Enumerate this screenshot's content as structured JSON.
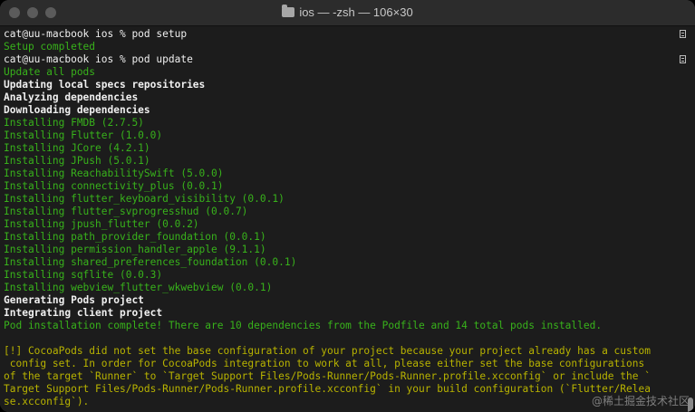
{
  "window": {
    "title": "ios — -zsh — 106×30"
  },
  "terminal": {
    "lines": [
      {
        "text": "cat@uu-macbook ios % pod setup",
        "style": "prompt"
      },
      {
        "text": "Setup completed",
        "style": "green"
      },
      {
        "text": "cat@uu-macbook ios % pod update",
        "style": "prompt"
      },
      {
        "text": "Update all pods",
        "style": "green"
      },
      {
        "text": "Updating local specs repositories",
        "style": "bold"
      },
      {
        "text": "Analyzing dependencies",
        "style": "bold"
      },
      {
        "text": "Downloading dependencies",
        "style": "bold"
      },
      {
        "text": "Installing FMDB (2.7.5)",
        "style": "green"
      },
      {
        "text": "Installing Flutter (1.0.0)",
        "style": "green"
      },
      {
        "text": "Installing JCore (4.2.1)",
        "style": "green"
      },
      {
        "text": "Installing JPush (5.0.1)",
        "style": "green"
      },
      {
        "text": "Installing ReachabilitySwift (5.0.0)",
        "style": "green"
      },
      {
        "text": "Installing connectivity_plus (0.0.1)",
        "style": "green"
      },
      {
        "text": "Installing flutter_keyboard_visibility (0.0.1)",
        "style": "green"
      },
      {
        "text": "Installing flutter_svprogresshud (0.0.7)",
        "style": "green"
      },
      {
        "text": "Installing jpush_flutter (0.0.2)",
        "style": "green"
      },
      {
        "text": "Installing path_provider_foundation (0.0.1)",
        "style": "green"
      },
      {
        "text": "Installing permission_handler_apple (9.1.1)",
        "style": "green"
      },
      {
        "text": "Installing shared_preferences_foundation (0.0.1)",
        "style": "green"
      },
      {
        "text": "Installing sqflite (0.0.3)",
        "style": "green"
      },
      {
        "text": "Installing webview_flutter_wkwebview (0.0.1)",
        "style": "green"
      },
      {
        "text": "Generating Pods project",
        "style": "bold"
      },
      {
        "text": "Integrating client project",
        "style": "bold"
      },
      {
        "text": "Pod installation complete! There are 10 dependencies from the Podfile and 14 total pods installed.",
        "style": "green"
      },
      {
        "text": "",
        "style": "plain"
      },
      {
        "text": "[!] CocoaPods did not set the base configuration of your project because your project already has a custom",
        "style": "yellow"
      },
      {
        "text": " config set. In order for CocoaPods integration to work at all, please either set the base configurations",
        "style": "yellow"
      },
      {
        "text": "of the target `Runner` to `Target Support Files/Pods-Runner/Pods-Runner.profile.xcconfig` or include the `",
        "style": "yellow"
      },
      {
        "text": "Target Support Files/Pods-Runner/Pods-Runner.profile.xcconfig` in your build configuration (`Flutter/Relea",
        "style": "yellow"
      },
      {
        "text": "se.xcconfig`).",
        "style": "yellow"
      }
    ]
  },
  "watermark": "@稀土掘金技术社区"
}
